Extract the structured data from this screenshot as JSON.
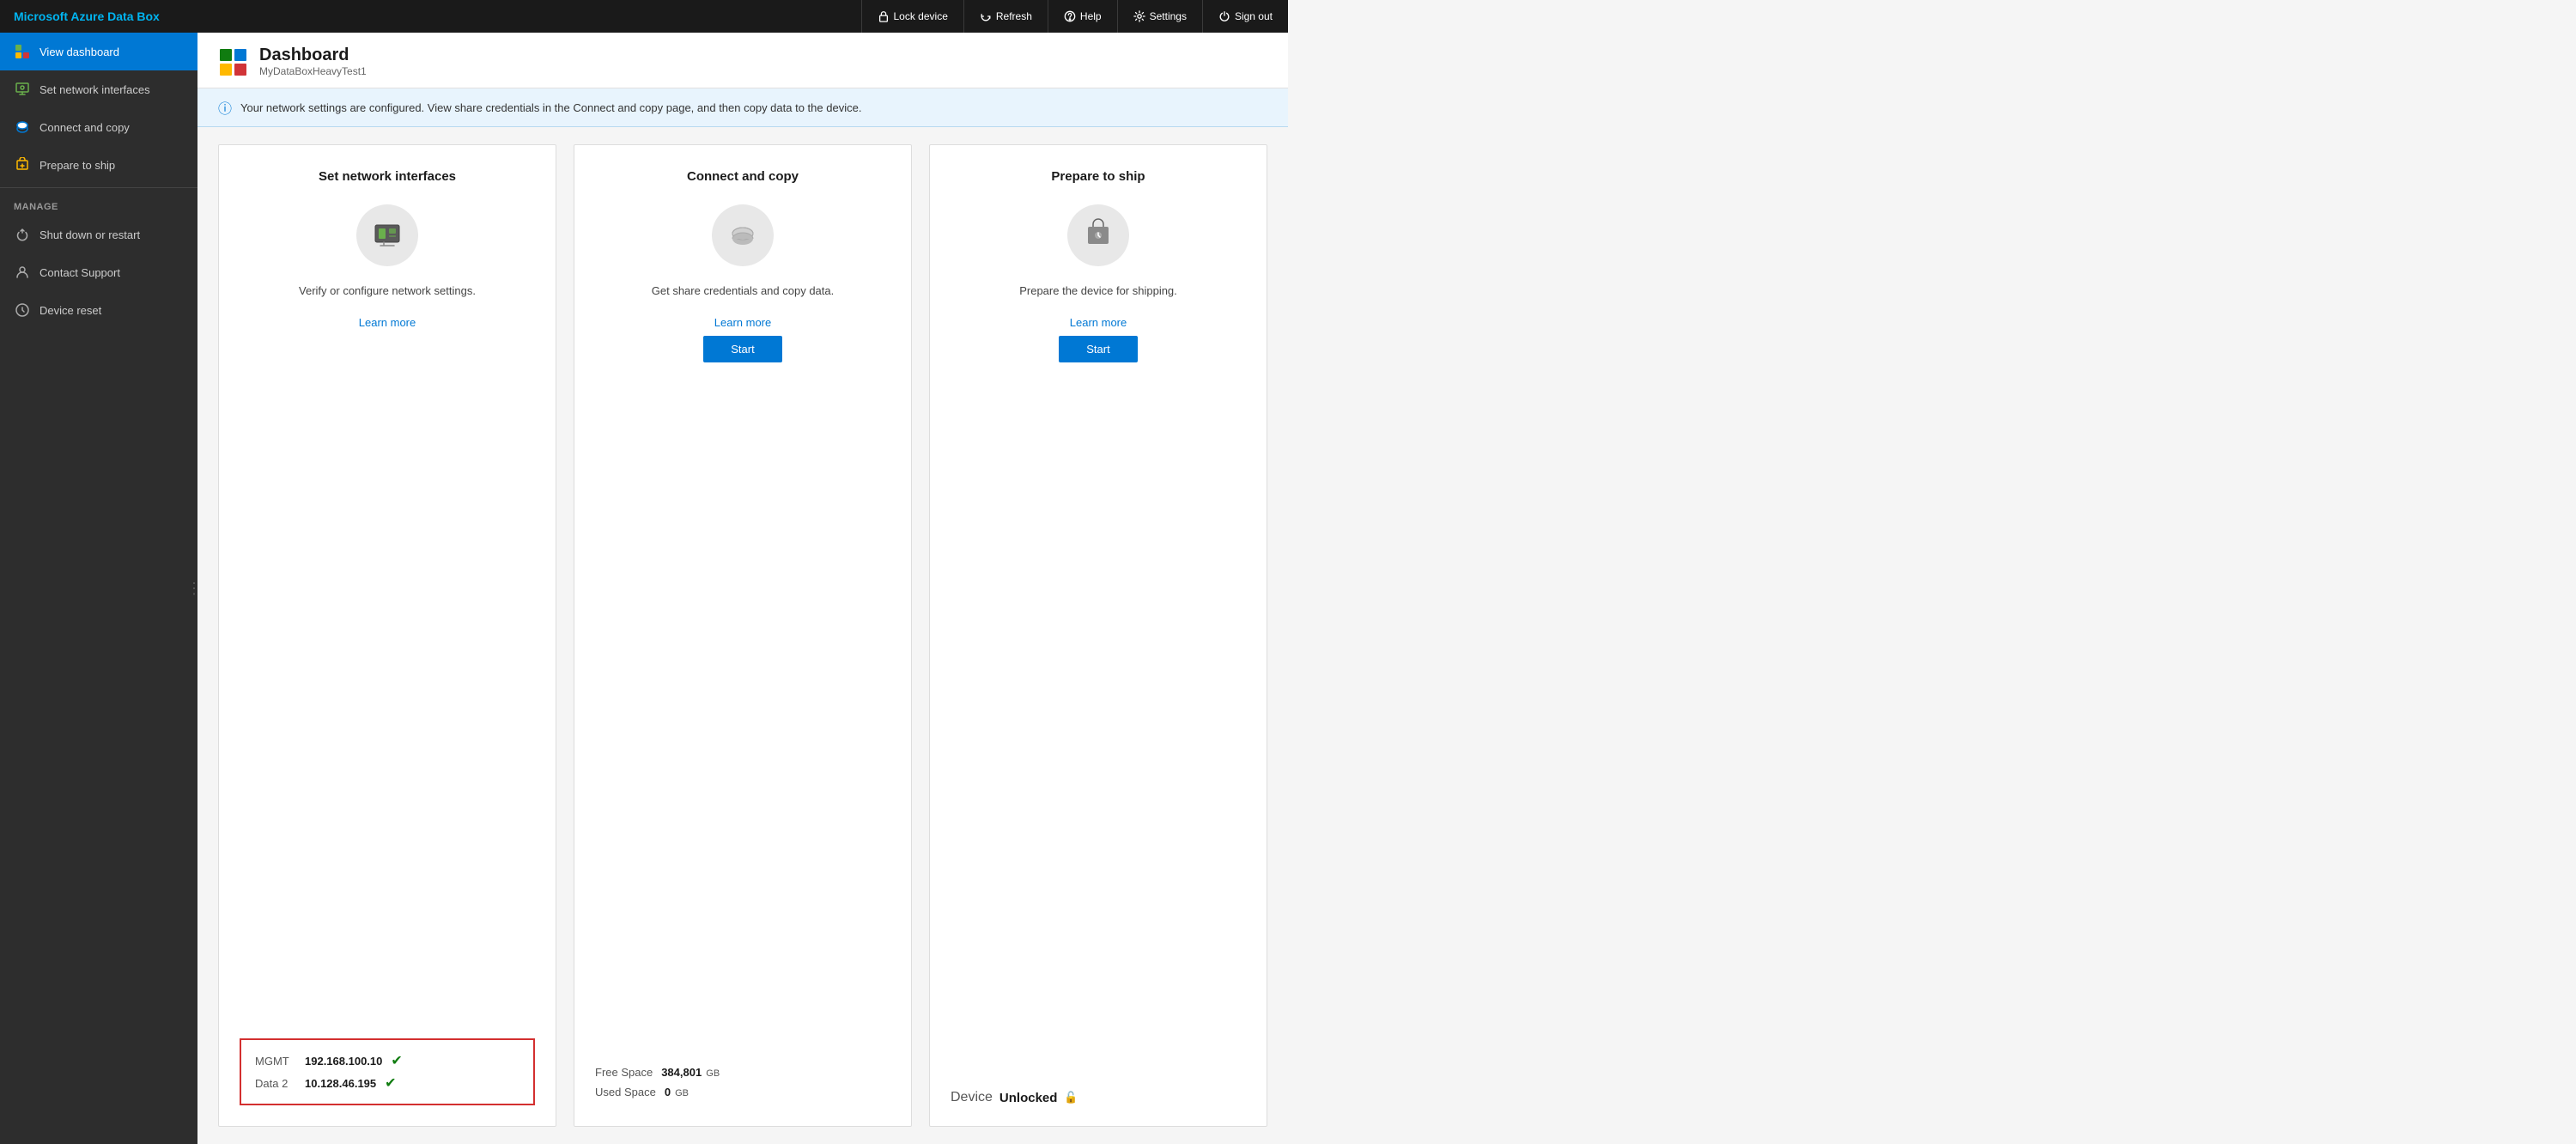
{
  "app": {
    "brand": "Microsoft Azure Data Box"
  },
  "topbar": {
    "actions": [
      {
        "id": "lock-device",
        "label": "Lock device",
        "icon": "lock"
      },
      {
        "id": "refresh",
        "label": "Refresh",
        "icon": "refresh"
      },
      {
        "id": "help",
        "label": "Help",
        "icon": "help"
      },
      {
        "id": "settings",
        "label": "Settings",
        "icon": "settings"
      },
      {
        "id": "sign-out",
        "label": "Sign out",
        "icon": "power"
      }
    ]
  },
  "sidebar": {
    "items": [
      {
        "id": "view-dashboard",
        "label": "View dashboard",
        "active": true,
        "icon": "grid"
      },
      {
        "id": "set-network-interfaces",
        "label": "Set network interfaces",
        "active": false,
        "icon": "network"
      },
      {
        "id": "connect-and-copy",
        "label": "Connect and copy",
        "active": false,
        "icon": "connect"
      },
      {
        "id": "prepare-to-ship",
        "label": "Prepare to ship",
        "active": false,
        "icon": "ship"
      }
    ],
    "manage_label": "MANAGE",
    "manage_items": [
      {
        "id": "shut-down-or-restart",
        "label": "Shut down or restart",
        "icon": "restart"
      },
      {
        "id": "contact-support",
        "label": "Contact Support",
        "icon": "support"
      },
      {
        "id": "device-reset",
        "label": "Device reset",
        "icon": "reset"
      }
    ]
  },
  "page": {
    "title": "Dashboard",
    "subtitle": "MyDataBoxHeavyTest1"
  },
  "banner": {
    "text": "Your network settings are configured. View share credentials in the Connect and copy page, and then copy data to the device."
  },
  "cards": [
    {
      "id": "set-network-interfaces",
      "title": "Set network interfaces",
      "description": "Verify or configure network settings.",
      "learn_more": "Learn more",
      "has_start": false,
      "data_type": "network",
      "data": [
        {
          "label": "MGMT",
          "value": "192.168.100.10",
          "status": "ok"
        },
        {
          "label": "Data 2",
          "value": "10.128.46.195",
          "status": "ok"
        }
      ]
    },
    {
      "id": "connect-and-copy",
      "title": "Connect and copy",
      "description": "Get share credentials and copy data.",
      "learn_more": "Learn more",
      "has_start": true,
      "start_label": "Start",
      "data_type": "storage",
      "data": [
        {
          "label": "Free Space",
          "value": "384,801",
          "unit": "GB"
        },
        {
          "label": "Used Space",
          "value": "0",
          "unit": "GB"
        }
      ]
    },
    {
      "id": "prepare-to-ship",
      "title": "Prepare to ship",
      "description": "Prepare the device for shipping.",
      "learn_more": "Learn more",
      "has_start": true,
      "start_label": "Start",
      "data_type": "device",
      "device_label": "Device",
      "device_status": "Unlocked"
    }
  ]
}
